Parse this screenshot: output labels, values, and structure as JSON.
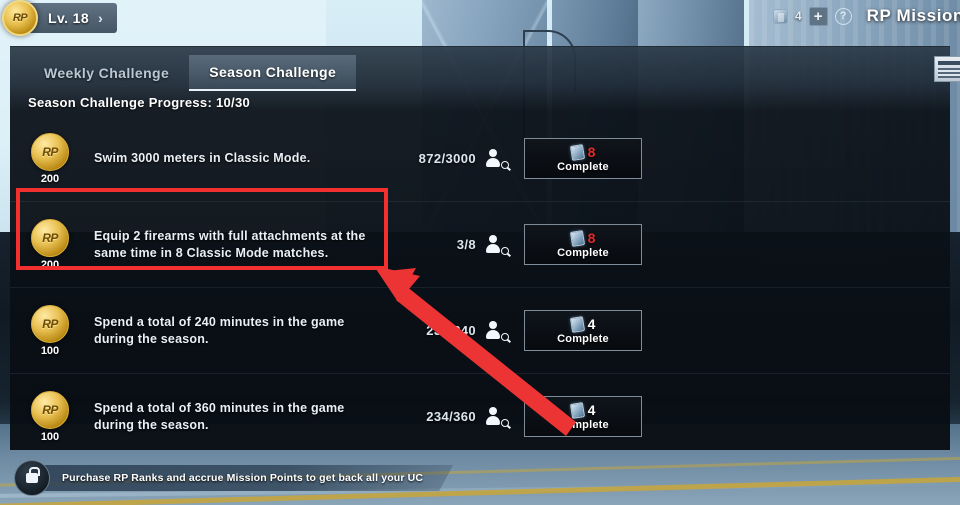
{
  "header": {
    "level_badge": {
      "medal_text": "RP",
      "label": "Lv. 18",
      "chevron": "›"
    },
    "currency": {
      "icon": "currency-card-icon",
      "value": "4"
    },
    "add_button": "+",
    "help_button": "?",
    "title": "RP Mission"
  },
  "tabs": [
    {
      "label": "Weekly Challenge",
      "active": false
    },
    {
      "label": "Season Challenge",
      "active": true
    }
  ],
  "progress_label": "Season Challenge Progress: 10/30",
  "rows": [
    {
      "reward_currency": "RP",
      "reward_amount": "200",
      "description": "Swim 3000 meters in Classic Mode.",
      "progress": "872/3000",
      "friend_icon": "find-teammate-icon",
      "button": {
        "ticket_icon": "ticket-icon",
        "count": "8",
        "count_color": "#e02b28",
        "label": "Complete"
      },
      "highlighted": false
    },
    {
      "reward_currency": "RP",
      "reward_amount": "200",
      "description": "Equip 2 firearms with full attachments at the same time in 8 Classic Mode matches.",
      "progress": "3/8",
      "friend_icon": "find-teammate-icon",
      "button": {
        "ticket_icon": "ticket-icon",
        "count": "8",
        "count_color": "#e02b28",
        "label": "Complete"
      },
      "highlighted": true
    },
    {
      "reward_currency": "RP",
      "reward_amount": "100",
      "description": "Spend a total of 240 minutes in the game during the season.",
      "progress": "234/240",
      "friend_icon": "find-teammate-icon",
      "button": {
        "ticket_icon": "ticket-icon",
        "count": "4",
        "count_color": "#ffffff",
        "label": "Complete"
      },
      "highlighted": false
    },
    {
      "reward_currency": "RP",
      "reward_amount": "100",
      "description": "Spend a total of 360 minutes in the game during the season.",
      "progress": "234/360",
      "friend_icon": "find-teammate-icon",
      "button": {
        "ticket_icon": "ticket-icon",
        "count": "4",
        "count_color": "#ffffff",
        "label": "Complete"
      },
      "highlighted": false
    }
  ],
  "bottom_banner": {
    "icon": "lock-icon",
    "text": "Purchase RP Ranks and accrue Mission Points to get back all your UC"
  },
  "annotations": {
    "highlight_color": "#f23030",
    "arrow_color": "#ec3434",
    "target_row_index": 1
  }
}
